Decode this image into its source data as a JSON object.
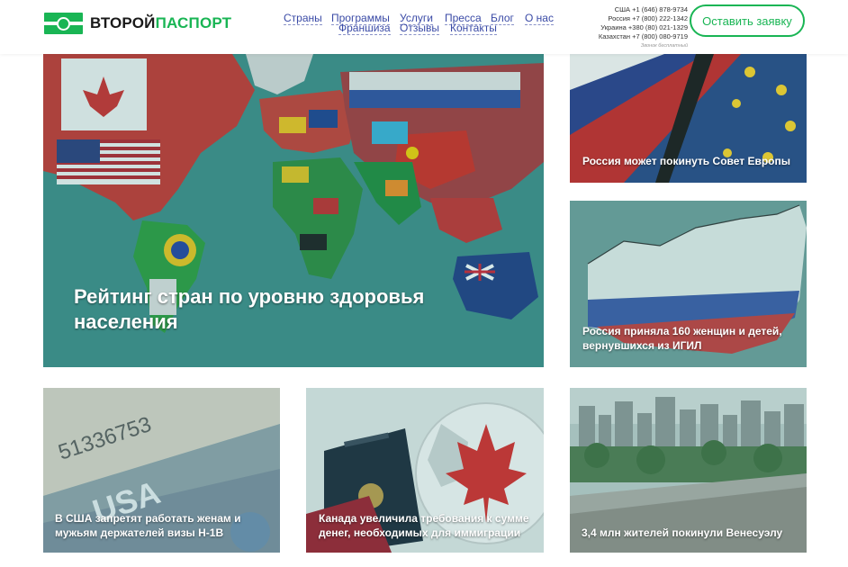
{
  "header": {
    "logo": {
      "part1": "ВТОРОЙ",
      "part2": "ПАСПОРТ"
    },
    "nav": [
      {
        "label": "Страны"
      },
      {
        "label": "Программы"
      },
      {
        "label": "Франшиза"
      },
      {
        "label": "Услуги"
      },
      {
        "label": "Отзывы"
      },
      {
        "label": "Пресса"
      },
      {
        "label": "Контакты"
      },
      {
        "label": "Блог"
      },
      {
        "label": "О нас"
      }
    ],
    "phones": [
      "США +1 (646) 878-9734",
      "Россия +7 (800) 222-1342",
      "Украина +380 (80) 021-1329",
      "Казахстан +7 (800) 080-9719"
    ],
    "phones_note": "Звонок бесплатный",
    "cta_label": "Оставить заявку"
  },
  "articles": {
    "featured": {
      "title": "Рейтинг стран по уровню здоровья населения"
    },
    "side1": {
      "title": "Россия может покинуть Совет Европы"
    },
    "side2": {
      "title": "Россия приняла 160 женщин и детей, вернувшихся из ИГИЛ"
    },
    "bottom1": {
      "title": "В США запретят работать женам и мужьям держателей визы H-1B"
    },
    "bottom2": {
      "title": "Канада увеличила требования к сумме денег, необходимых для иммиграции"
    },
    "bottom3": {
      "title": "3,4 млн жителей покинули Венесуэлу"
    }
  },
  "colors": {
    "accent": "#19b554",
    "nav_link": "#3a4aa6",
    "overlay": "#2f8d86"
  }
}
